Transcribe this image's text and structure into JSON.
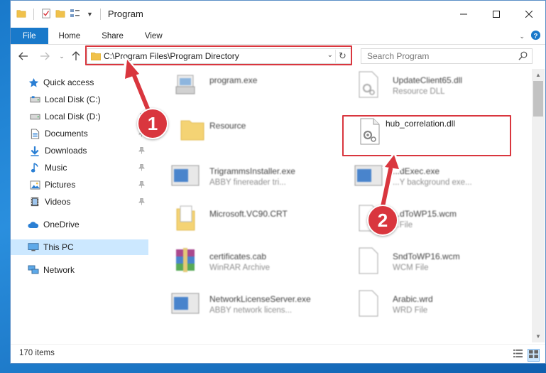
{
  "window": {
    "title": "Program"
  },
  "ribbon": {
    "tabs": [
      "File",
      "Home",
      "Share",
      "View"
    ]
  },
  "address": {
    "path": "C:\\Program Files\\Program Directory"
  },
  "search": {
    "placeholder": "Search Program"
  },
  "nav": {
    "items": [
      {
        "label": "Quick access",
        "icon": "star-icon"
      },
      {
        "label": "Local Disk (C:)",
        "icon": "drive-icon"
      },
      {
        "label": "Local Disk (D:)",
        "icon": "drive-icon"
      },
      {
        "label": "Documents",
        "icon": "documents-icon"
      },
      {
        "label": "Downloads",
        "icon": "downloads-icon"
      },
      {
        "label": "Music",
        "icon": "music-icon"
      },
      {
        "label": "Pictures",
        "icon": "pictures-icon"
      },
      {
        "label": "Videos",
        "icon": "videos-icon"
      },
      {
        "label": "OneDrive",
        "icon": "cloud-icon"
      },
      {
        "label": "This PC",
        "icon": "pc-icon"
      },
      {
        "label": "Network",
        "icon": "network-icon"
      }
    ]
  },
  "files": [
    {
      "name": "program.exe",
      "type": ""
    },
    {
      "name": "UpdateClient65.dll",
      "type": "Resource DLL"
    },
    {
      "name": "Resource",
      "type": ""
    },
    {
      "name": "hub_correlation.dll",
      "type": ""
    },
    {
      "name": "TrigrammsInstaller.exe",
      "type": "ABBY finereader tri..."
    },
    {
      "name": "...dExec.exe",
      "type": "...Y background exe..."
    },
    {
      "name": "Microsoft.VC90.CRT",
      "type": ""
    },
    {
      "name": "...dToWP15.wcm",
      "type": "...File"
    },
    {
      "name": "certificates.cab",
      "type": "WinRAR Archive"
    },
    {
      "name": "SndToWP16.wcm",
      "type": "WCM File"
    },
    {
      "name": "NetworkLicenseServer.exe",
      "type": "ABBY network licens..."
    },
    {
      "name": "Arabic.wrd",
      "type": "WRD File"
    }
  ],
  "status": {
    "item_count": "170 items"
  },
  "annotations": {
    "step1": "1",
    "step2": "2"
  },
  "colors": {
    "accent": "#1979ca",
    "highlight": "#d9363e",
    "selected": "#cce8ff"
  }
}
